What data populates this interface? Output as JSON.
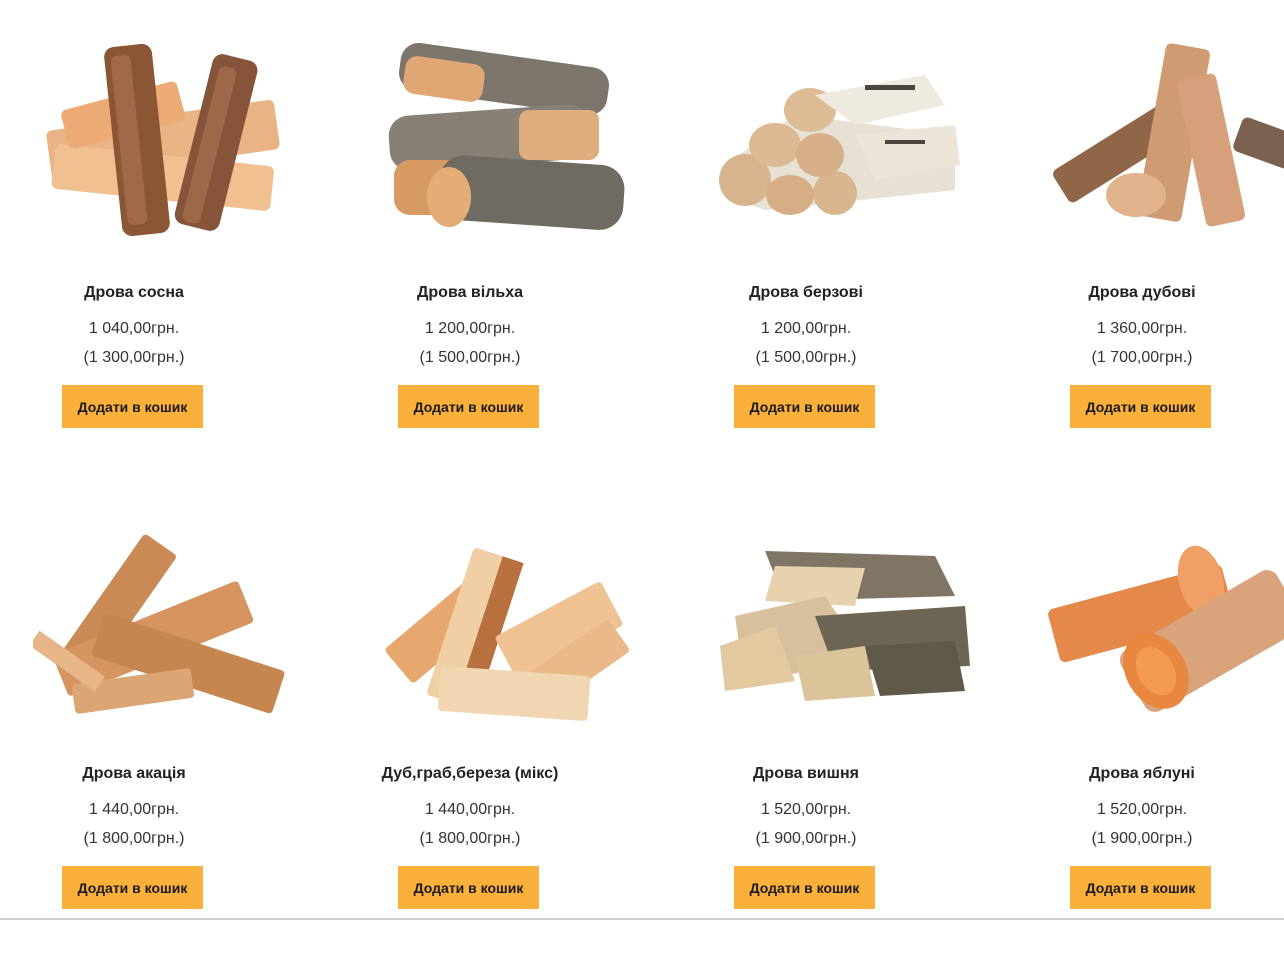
{
  "cart_button_label": "Додати в кошик",
  "colors": {
    "button_bg": "#fbb03b",
    "wood_light": "#e9c08f",
    "wood_orange": "#e58a4a",
    "bark_brown": "#6b4a32",
    "bark_grey": "#8a8279",
    "birch_white": "#ece8df"
  },
  "products": [
    {
      "title": "Дрова сосна",
      "price": "1 040,00грн.",
      "old_price": "(1 300,00грн.)",
      "image": "pine-firewood"
    },
    {
      "title": "Дрова вільха",
      "price": "1 200,00грн.",
      "old_price": "(1 500,00грн.)",
      "image": "alder-firewood"
    },
    {
      "title": "Дрова берзові",
      "price": "1 200,00грн.",
      "old_price": "(1 500,00грн.)",
      "image": "birch-firewood"
    },
    {
      "title": "Дрова дубові",
      "price": "1 360,00грн.",
      "old_price": "(1 700,00грн.)",
      "image": "oak-firewood"
    },
    {
      "title": "Дрова акація",
      "price": "1 440,00грн.",
      "old_price": "(1 800,00грн.)",
      "image": "acacia-firewood"
    },
    {
      "title": "Дуб,граб,береза (мікс)",
      "price": "1 440,00грн.",
      "old_price": "(1 800,00грн.)",
      "image": "mixed-firewood"
    },
    {
      "title": "Дрова вишня",
      "price": "1 520,00грн.",
      "old_price": "(1 900,00грн.)",
      "image": "cherry-firewood"
    },
    {
      "title": "Дрова яблуні",
      "price": "1 520,00грн.",
      "old_price": "(1 900,00грн.)",
      "image": "apple-firewood"
    }
  ]
}
